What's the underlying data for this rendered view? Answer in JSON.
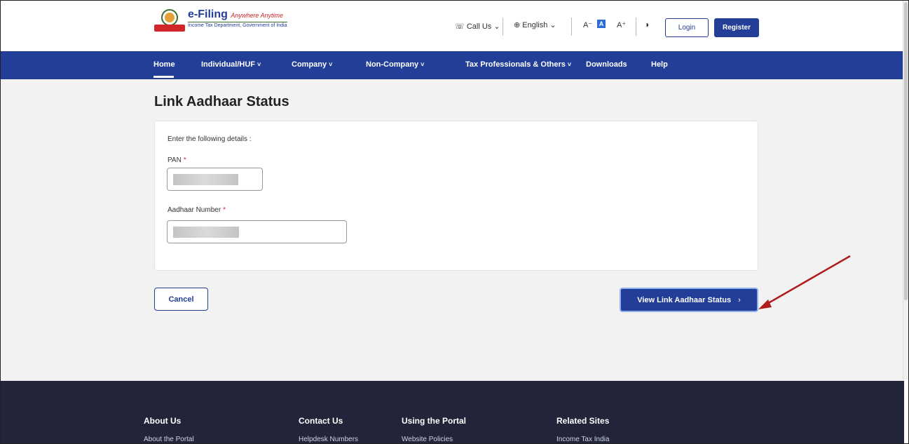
{
  "header": {
    "logo": {
      "title": "e-Filing",
      "tagline": "Anywhere Anytime",
      "subtitle": "Income Tax Department, Government of India"
    },
    "call_us": "Call Us",
    "language": "English",
    "font_smaller": "A⁻",
    "font_default": "A",
    "font_larger": "A⁺",
    "login_label": "Login",
    "register_label": "Register"
  },
  "nav": {
    "items": [
      {
        "label": "Home",
        "dropdown": false
      },
      {
        "label": "Individual/HUF",
        "dropdown": true
      },
      {
        "label": "Company",
        "dropdown": true
      },
      {
        "label": "Non-Company",
        "dropdown": true
      },
      {
        "label": "Tax Professionals & Others",
        "dropdown": true
      },
      {
        "label": "Downloads",
        "dropdown": false
      },
      {
        "label": "Help",
        "dropdown": false
      }
    ],
    "chevron": "˅"
  },
  "main": {
    "title": "Link Aadhaar Status",
    "instruction": "Enter the following details :",
    "pan_label": "PAN",
    "aadhaar_label": "Aadhaar Number",
    "required_mark": "*",
    "cancel_label": "Cancel",
    "view_label": "View Link Aadhaar Status",
    "view_arrow": "›"
  },
  "footer": {
    "columns": [
      {
        "heading": "About Us",
        "link": "About the Portal"
      },
      {
        "heading": "Contact Us",
        "link": "Helpdesk Numbers"
      },
      {
        "heading": "Using the Portal",
        "link": "Website Policies"
      },
      {
        "heading": "Related Sites",
        "link": "Income Tax India"
      }
    ]
  },
  "colors": {
    "brand_blue": "#233e97",
    "footer_bg": "#22243a",
    "annotation_red": "#b01c1c",
    "required_red": "#d0262a"
  },
  "icons": {
    "phone": "phone-icon",
    "globe": "globe-icon",
    "contrast": "contrast-icon",
    "chevron": "chevron-down-icon"
  }
}
